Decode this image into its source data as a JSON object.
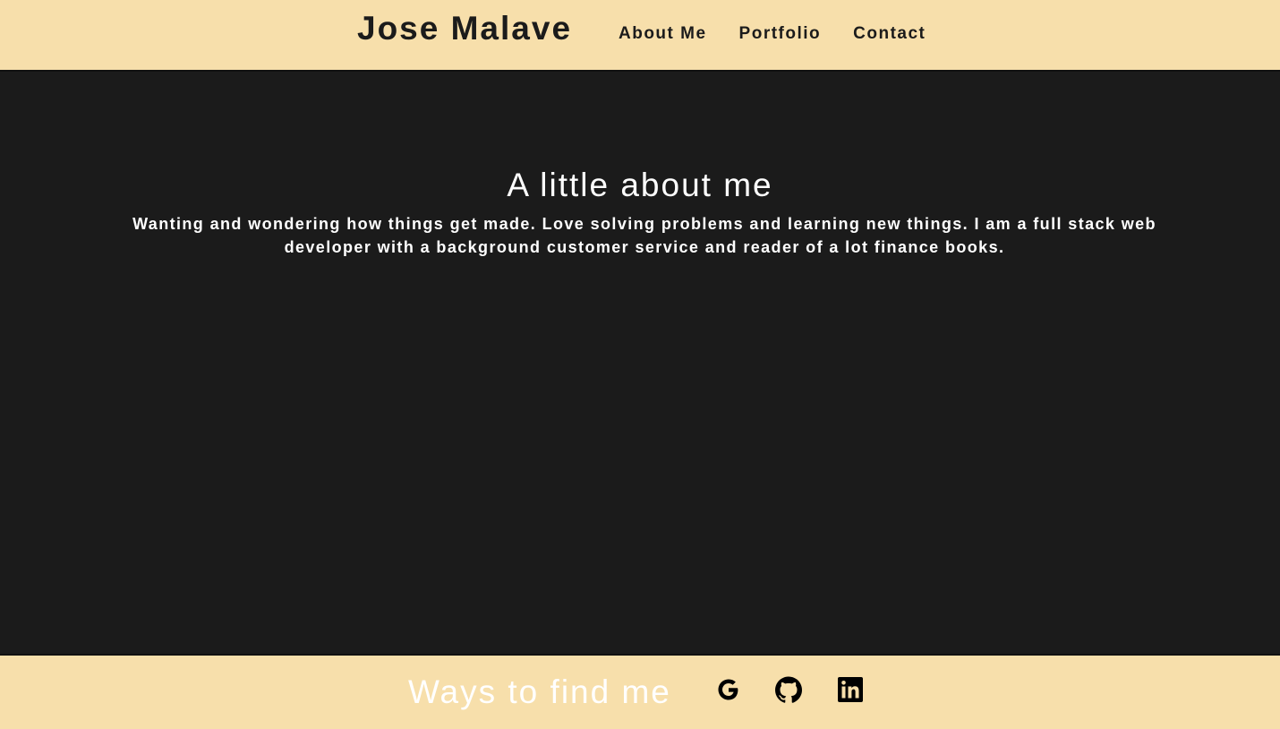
{
  "header": {
    "brand": "Jose Malave",
    "nav": [
      {
        "label": "About Me"
      },
      {
        "label": "Portfolio"
      },
      {
        "label": "Contact"
      }
    ]
  },
  "about": {
    "title": "A little about me",
    "text": "Wanting and wondering how things get made. Love solving problems and learning new things. I am a full stack web developer with a background customer service and reader of a lot finance books."
  },
  "footer": {
    "title": "Ways to find me",
    "links": [
      {
        "icon": "google-icon"
      },
      {
        "icon": "github-icon"
      },
      {
        "icon": "linkedin-icon"
      }
    ]
  },
  "colors": {
    "header_bg": "#f7dfab",
    "main_bg": "#1b1b1b",
    "text_light": "#ffffff",
    "text_dark": "#1b1b1b"
  }
}
